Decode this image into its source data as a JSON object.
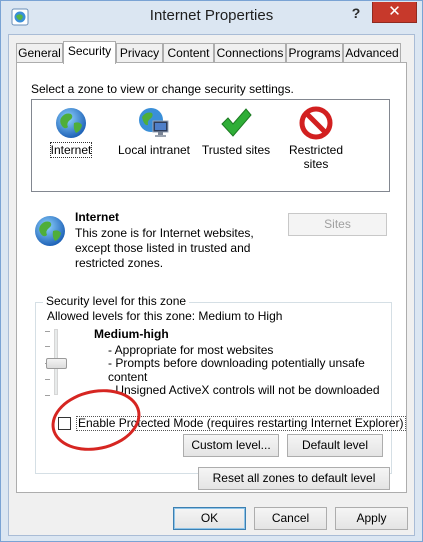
{
  "window": {
    "title": "Internet Properties",
    "help_label": "?",
    "close_label": "✕"
  },
  "tabs": [
    {
      "label": "General",
      "active": false
    },
    {
      "label": "Security",
      "active": true
    },
    {
      "label": "Privacy",
      "active": false
    },
    {
      "label": "Content",
      "active": false
    },
    {
      "label": "Connections",
      "active": false
    },
    {
      "label": "Programs",
      "active": false
    },
    {
      "label": "Advanced",
      "active": false
    }
  ],
  "security": {
    "zone_prompt": "Select a zone to view or change security settings.",
    "zones": [
      {
        "label": "Internet",
        "icon": "globe-icon",
        "selected": true
      },
      {
        "label": "Local intranet",
        "icon": "intranet-icon",
        "selected": false
      },
      {
        "label": "Trusted sites",
        "icon": "checkmark-icon",
        "selected": false
      },
      {
        "label": "Restricted sites",
        "icon": "restricted-icon",
        "selected": false
      }
    ],
    "info": {
      "title": "Internet",
      "description": "This zone is for Internet websites, except those listed in trusted and restricted zones.",
      "sites_button": "Sites"
    },
    "level_group": {
      "legend": "Security level for this zone",
      "allowed": "Allowed levels for this zone: Medium to High",
      "level_name": "Medium-high",
      "details": [
        "- Appropriate for most websites",
        "- Prompts before downloading potentially unsafe content",
        "- Unsigned ActiveX controls will not be downloaded"
      ],
      "protected_mode_label": "Enable Protected Mode (requires restarting Internet Explorer)",
      "protected_mode_checked": false,
      "custom_level_button": "Custom level...",
      "default_level_button": "Default level"
    },
    "reset_all_button": "Reset all zones to default level"
  },
  "footer": {
    "ok": "OK",
    "cancel": "Cancel",
    "apply": "Apply"
  },
  "colors": {
    "accent_red": "#d62521",
    "check_green": "#2fae37"
  }
}
